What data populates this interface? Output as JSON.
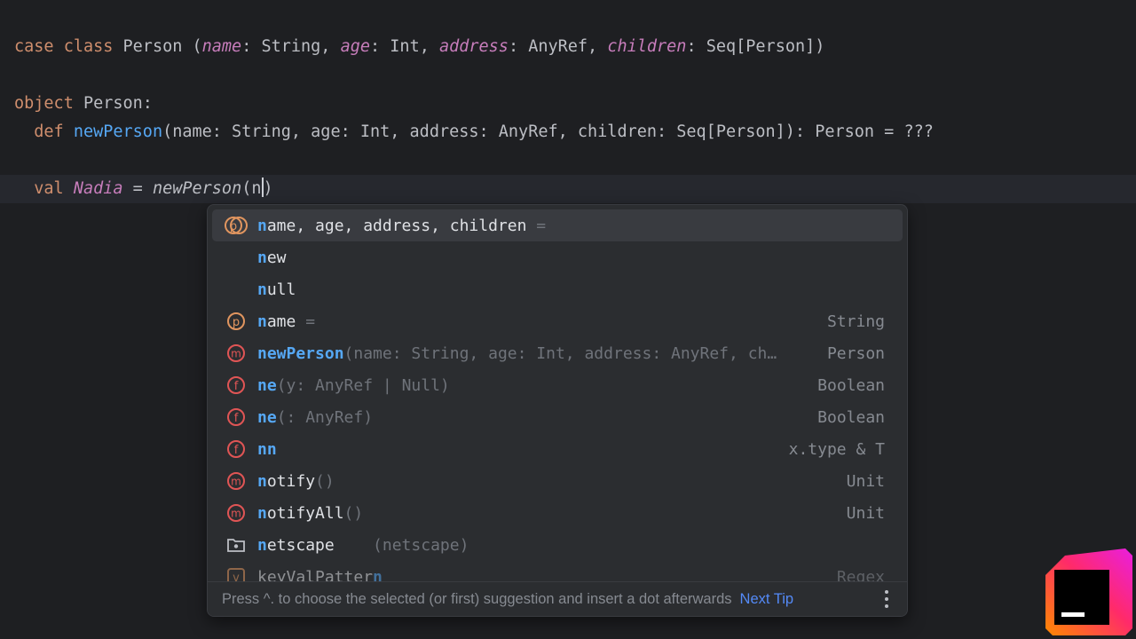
{
  "editor": {
    "line1": {
      "kw": "case class",
      "cls": " Person (",
      "p1": "name",
      "t1": ": String, ",
      "p2": "age",
      "t2": ": Int, ",
      "p3": "address",
      "t3": ": AnyRef, ",
      "p4": "children",
      "t4": ": Seq[Person])"
    },
    "line2": {
      "kw": "object",
      "rest": " Person:"
    },
    "line3": {
      "kw": "def",
      "fn": "newPerson",
      "rest": "(name: String, age: Int, address: AnyRef, children: Seq[Person]): Person = ???"
    },
    "line4": {
      "kw": "val",
      "var": "Nadia",
      "eq": " = ",
      "call": "newPerson",
      "open": "(n",
      "close": ")"
    }
  },
  "completion": {
    "items": [
      {
        "icon": "parameters-icon",
        "match": "n",
        "rest": "ame, age, address, children",
        "tail": " =",
        "type": ""
      },
      {
        "icon": "",
        "match": "n",
        "rest": "ew",
        "tail": "",
        "type": ""
      },
      {
        "icon": "",
        "match": "n",
        "rest": "ull",
        "tail": "",
        "type": ""
      },
      {
        "icon": "parameter-icon",
        "match": "n",
        "rest": "ame",
        "tail": " =",
        "type": "String"
      },
      {
        "icon": "method-icon",
        "match": "newPerson",
        "rest": "",
        "tail": "(name: String, age: Int, address: AnyRef, ch…",
        "type": "Person"
      },
      {
        "icon": "function-icon",
        "match": "ne",
        "rest": "",
        "tail": "(y: AnyRef | Null)",
        "type": "Boolean"
      },
      {
        "icon": "function-icon",
        "match": "ne",
        "rest": "",
        "tail": "(: AnyRef)",
        "type": "Boolean"
      },
      {
        "icon": "function-icon",
        "match": "nn",
        "rest": "",
        "tail": "",
        "type": "x.type & T"
      },
      {
        "icon": "method-icon",
        "match": "n",
        "rest": "otify",
        "tail": "()",
        "type": "Unit"
      },
      {
        "icon": "method-icon",
        "match": "n",
        "rest": "otifyAll",
        "tail": "()",
        "type": "Unit"
      },
      {
        "icon": "package-icon",
        "match": "n",
        "rest": "etscape",
        "tail": "    (netscape)",
        "type": ""
      },
      {
        "icon": "value-icon",
        "match": "",
        "rest": "keyValPatter",
        "tail": "n",
        "type": "Regex"
      }
    ],
    "footer": {
      "hint": "Press ^. to choose the selected (or first) suggestion and insert a dot afterwards",
      "next_tip": "Next Tip"
    }
  },
  "colors": {
    "background": "#1e1f22",
    "keyword": "#cf8e6d",
    "parameter": "#c77dbb",
    "function": "#56a8f5",
    "icon_orange": "#e0955f",
    "icon_red": "#e05555"
  }
}
